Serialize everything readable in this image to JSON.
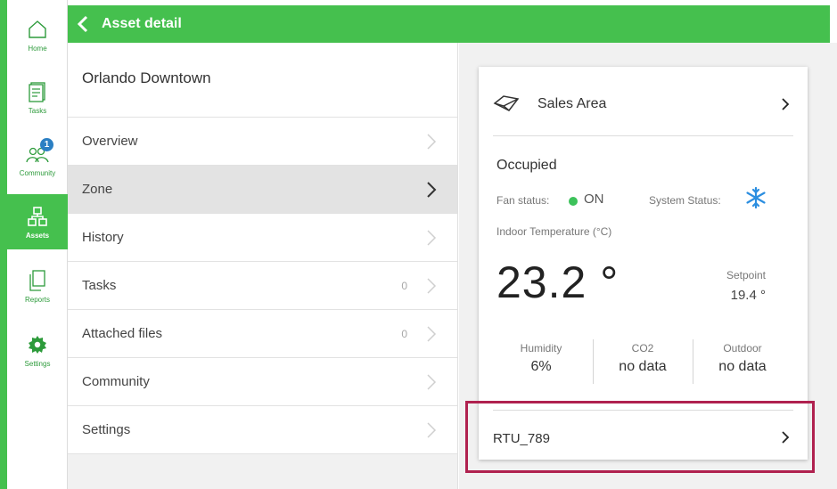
{
  "nav": {
    "items": [
      {
        "label": "Home",
        "icon": "home-icon"
      },
      {
        "label": "Tasks",
        "icon": "tasks-icon"
      },
      {
        "label": "Community",
        "icon": "community-icon",
        "badge": "1"
      },
      {
        "label": "Assets",
        "icon": "assets-icon",
        "active": true
      },
      {
        "label": "Reports",
        "icon": "reports-icon"
      },
      {
        "label": "Settings",
        "icon": "settings-icon"
      }
    ],
    "accent_color": "#45c04e",
    "badge_color": "#2b7fc3"
  },
  "header": {
    "title": "Asset detail",
    "back_icon": "chevron-left-icon"
  },
  "asset": {
    "site_name": "Orlando Downtown",
    "menu": [
      {
        "label": "Overview"
      },
      {
        "label": "Zone",
        "selected": true
      },
      {
        "label": "History"
      },
      {
        "label": "Tasks",
        "count": "0"
      },
      {
        "label": "Attached files",
        "count": "0"
      },
      {
        "label": "Community"
      },
      {
        "label": "Settings"
      }
    ]
  },
  "zone_card": {
    "zone_icon": "zone-diamond-icon",
    "zone_name": "Sales Area",
    "occupancy": "Occupied",
    "fan_status_label": "Fan status:",
    "fan_status_value": "ON",
    "fan_status_color": "#3cc25a",
    "system_status_label": "System Status:",
    "system_status_icon": "snowflake-icon",
    "system_status_color": "#2b8ee0",
    "indoor_temp_label": "Indoor Temperature (°C)",
    "indoor_temp_value": "23.2 °",
    "setpoint_label": "Setpoint",
    "setpoint_value": "19.4 °",
    "stats": [
      {
        "label": "Humidity",
        "value": "6%"
      },
      {
        "label": "CO2",
        "value": "no data"
      },
      {
        "label": "Outdoor",
        "value": "no data"
      }
    ],
    "equipment": "RTU_789",
    "highlight_color": "#b0214f"
  }
}
